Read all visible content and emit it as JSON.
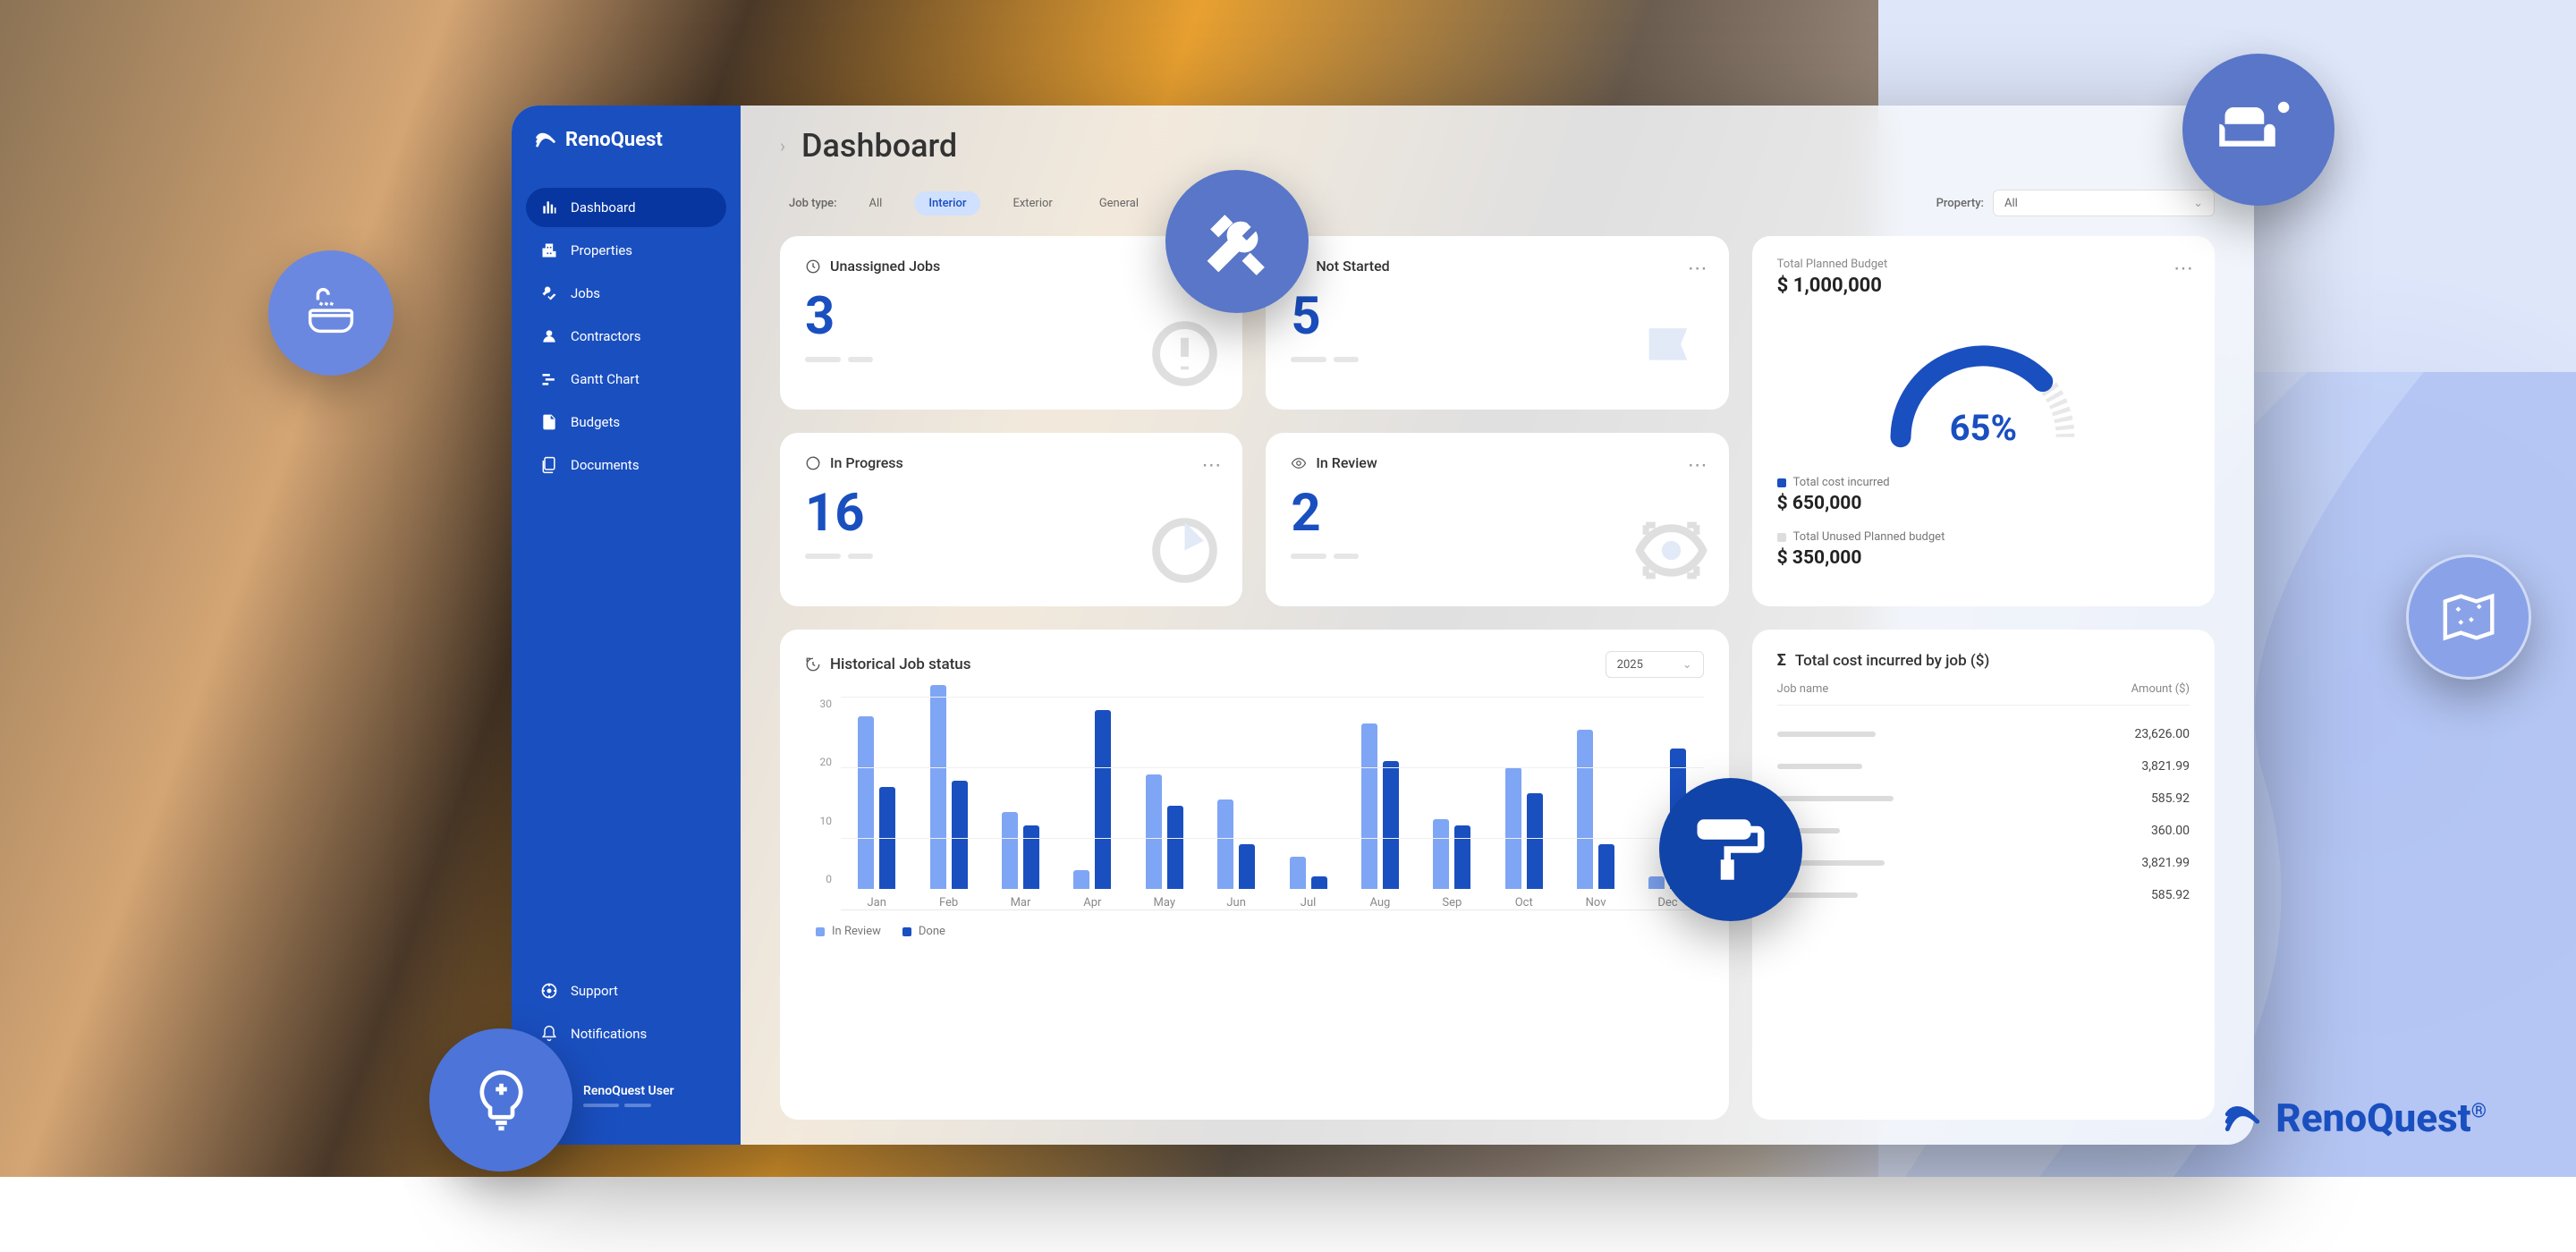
{
  "brand": "RenoQuest",
  "page_title": "Dashboard",
  "sidebar": {
    "items": [
      {
        "label": "Dashboard",
        "active": true
      },
      {
        "label": "Properties"
      },
      {
        "label": "Jobs"
      },
      {
        "label": "Contractors"
      },
      {
        "label": "Gantt Chart"
      },
      {
        "label": "Budgets"
      },
      {
        "label": "Documents"
      }
    ],
    "bottom": [
      {
        "label": "Support"
      },
      {
        "label": "Notifications"
      }
    ],
    "user_name": "RenoQuest User"
  },
  "filters": {
    "job_type_label": "Job type:",
    "job_types": [
      "All",
      "Interior",
      "Exterior",
      "General"
    ],
    "job_types_active": "Interior",
    "property_label": "Property:",
    "property_value": "All"
  },
  "cards": {
    "unassigned": {
      "title": "Unassigned Jobs",
      "value": "3"
    },
    "not_started": {
      "title": "Not Started",
      "value": "5"
    },
    "in_progress": {
      "title": "In Progress",
      "value": "16"
    },
    "in_review": {
      "title": "In Review",
      "value": "2"
    }
  },
  "budget": {
    "total_label": "Total Planned Budget",
    "total_value": "$ 1,000,000",
    "percent": "65%",
    "incurred_label": "Total cost incurred",
    "incurred_value": "$ 650,000",
    "unused_label": "Total Unused Planned budget",
    "unused_value": "$ 350,000"
  },
  "historical": {
    "title": "Historical Job status",
    "year": "2025",
    "legend_review": "In Review",
    "legend_done": "Done"
  },
  "cost_table": {
    "title": "Total cost incurred by job ($)",
    "col_job": "Job name",
    "col_amount": "Amount ($)",
    "rows": [
      {
        "amount": "23,626.00"
      },
      {
        "amount": "3,821.99"
      },
      {
        "amount": "585.92"
      },
      {
        "amount": "360.00"
      },
      {
        "amount": "3,821.99"
      },
      {
        "amount": "585.92"
      }
    ]
  },
  "chart_data": {
    "type": "bar",
    "title": "Historical Job status",
    "categories": [
      "Jan",
      "Feb",
      "Mar",
      "Apr",
      "May",
      "Jun",
      "Jul",
      "Aug",
      "Sep",
      "Oct",
      "Nov",
      "Dec"
    ],
    "series": [
      {
        "name": "In Review",
        "values": [
          27,
          32,
          12,
          3,
          18,
          14,
          5,
          26,
          11,
          19,
          25,
          2
        ]
      },
      {
        "name": "Done",
        "values": [
          16,
          17,
          10,
          28,
          13,
          7,
          2,
          20,
          10,
          15,
          7,
          22
        ]
      }
    ],
    "ylim": [
      0,
      30
    ],
    "yticks": [
      0,
      10,
      20,
      30
    ],
    "xlabel": "",
    "ylabel": ""
  }
}
